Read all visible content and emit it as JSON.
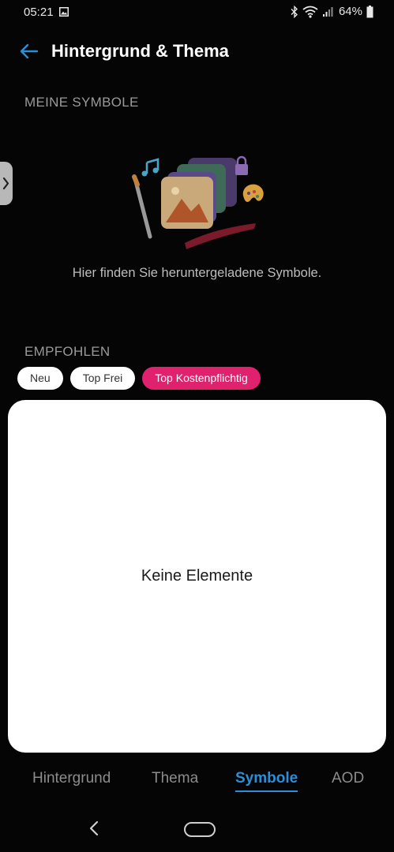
{
  "status_bar": {
    "time": "05:21",
    "battery": "64%",
    "icons": [
      "gallery-icon",
      "bluetooth-icon",
      "wifi-icon",
      "signal-icon",
      "battery-icon"
    ]
  },
  "header": {
    "title": "Hintergrund & Thema",
    "back_icon": "back-arrow-icon"
  },
  "my_symbols": {
    "section_title": "MEINE SYMBOLE",
    "empty_text": "Hier finden Sie heruntergeladene Symbole."
  },
  "recommended": {
    "section_title": "EMPFOHLEN",
    "filters": [
      {
        "label": "Neu",
        "active": false
      },
      {
        "label": "Top Frei",
        "active": false
      },
      {
        "label": "Top Kostenpflichtig",
        "active": true
      }
    ],
    "empty_text": "Keine Elemente"
  },
  "tabs": [
    {
      "label": "Hintergrund",
      "active": false
    },
    {
      "label": "Thema",
      "active": false
    },
    {
      "label": "Symbole",
      "active": true
    },
    {
      "label": "AOD",
      "active": false
    }
  ],
  "colors": {
    "accent": "#2b8fd8",
    "chip_active": "#e0216e",
    "background": "#050505"
  }
}
